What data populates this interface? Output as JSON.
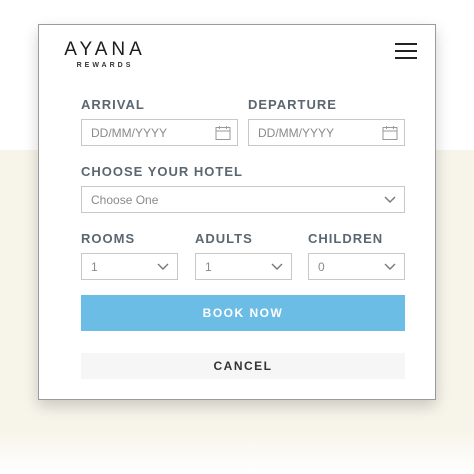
{
  "brand": {
    "name": "AYANA",
    "sub": "REWARDS"
  },
  "menu_icon": "hamburger-menu-icon",
  "form": {
    "arrival": {
      "label": "ARRIVAL",
      "placeholder": "DD/MM/YYYY",
      "icon": "calendar-icon"
    },
    "departure": {
      "label": "DEPARTURE",
      "placeholder": "DD/MM/YYYY",
      "icon": "calendar-icon"
    },
    "hotel": {
      "label": "CHOOSE YOUR HOTEL",
      "value": "Choose One"
    },
    "rooms": {
      "label": "ROOMS",
      "value": "1"
    },
    "adults": {
      "label": "ADULTS",
      "value": "1"
    },
    "children": {
      "label": "CHILDREN",
      "value": "0"
    },
    "book_label": "BOOK NOW",
    "cancel_label": "CANCEL"
  },
  "colors": {
    "accent": "#6cbde6",
    "label": "#5a6670",
    "backdrop": "#f7f4ea"
  }
}
